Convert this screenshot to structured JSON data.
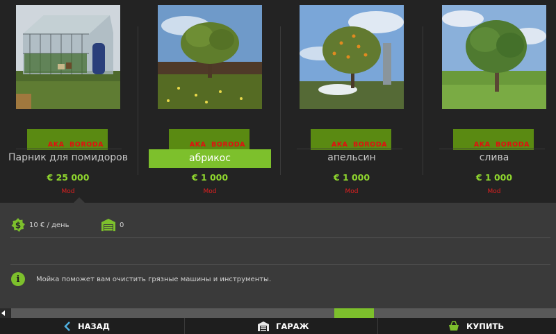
{
  "shop": {
    "items": [
      {
        "title": "Парник для помидоров",
        "price": "€ 25 000",
        "tag": "Mod",
        "badge": "AKA  BORODA",
        "selected": false
      },
      {
        "title": "абрикос",
        "price": "€ 1 000",
        "tag": "Mod",
        "badge": "AKA  BORODA",
        "selected": true
      },
      {
        "title": "апельсин",
        "price": "€ 1 000",
        "tag": "Mod",
        "badge": "AKA  BORODA",
        "selected": false
      },
      {
        "title": "слива",
        "price": "€ 1 000",
        "tag": "Mod",
        "badge": "AKA  BORODA",
        "selected": false
      }
    ]
  },
  "details": {
    "upkeep": "10 € / день",
    "upkeep_icon": "dollar-icon",
    "garage_count": "0",
    "garage_icon": "garage-icon",
    "description": "Мойка поможет вам очистить грязные машины и инструменты.",
    "info_glyph": "i"
  },
  "scrollbar": {
    "position": 0.64
  },
  "bottom_bar": {
    "back_label": "НАЗАД",
    "garage_label": "ГАРАЖ",
    "buy_label": "КУПИТЬ"
  },
  "colors": {
    "accent": "#7dc02c",
    "price": "#8fd62e",
    "mod_tag": "#e02020",
    "badge_bg": "#5a8a12",
    "badge_text": "#e01010"
  }
}
